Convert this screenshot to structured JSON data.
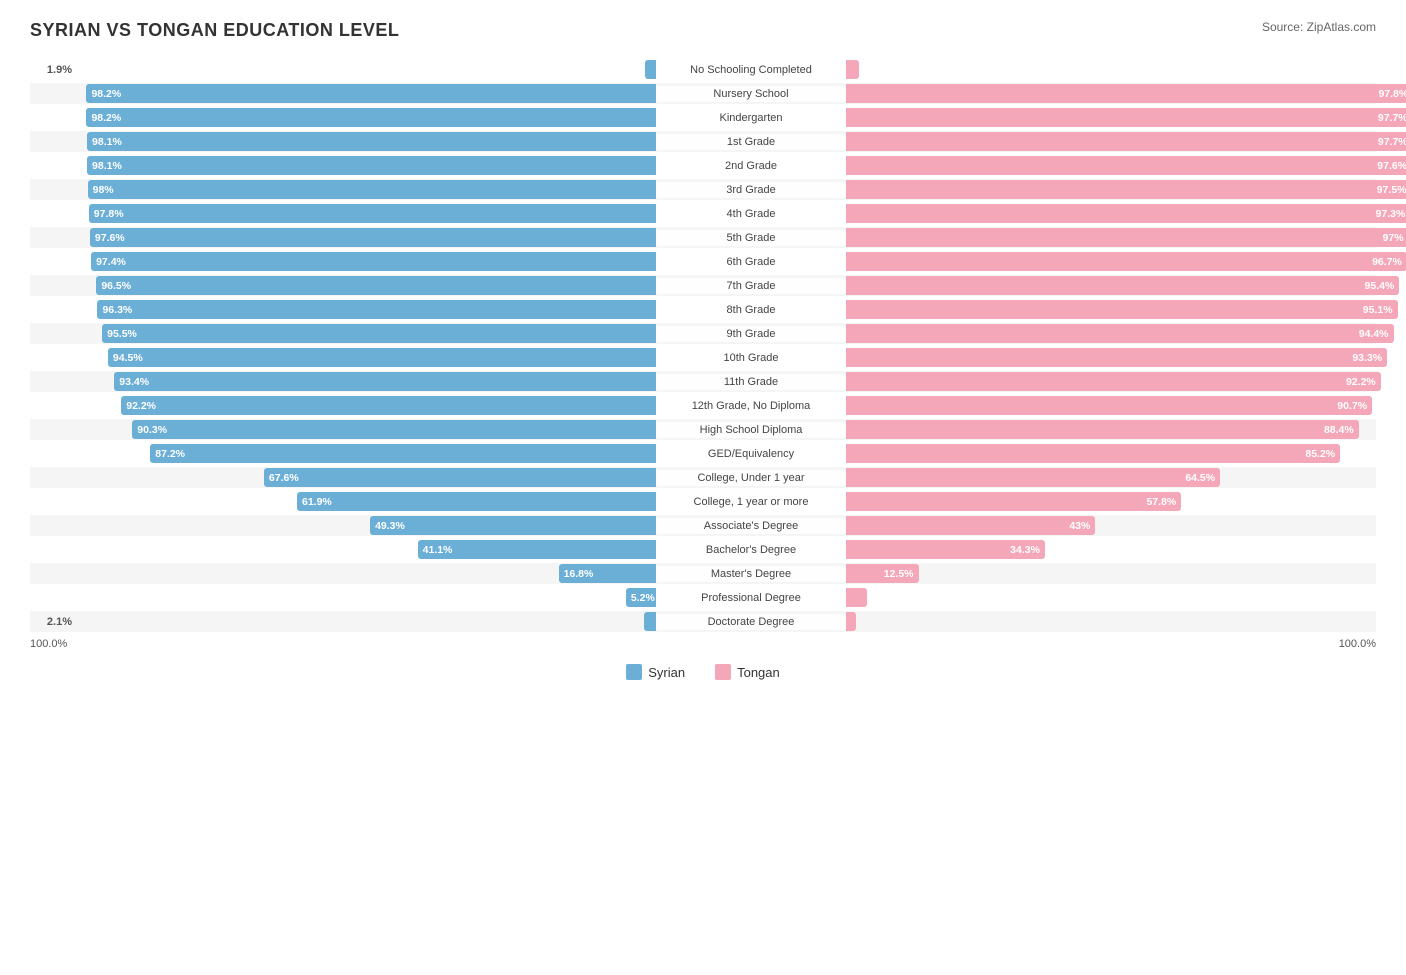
{
  "title": "SYRIAN VS TONGAN EDUCATION LEVEL",
  "source": "Source: ZipAtlas.com",
  "colors": {
    "syrian": "#6baed6",
    "tongan": "#f4a7b9"
  },
  "legend": {
    "syrian": "Syrian",
    "tongan": "Tongan"
  },
  "bottom_left": "100.0%",
  "bottom_right": "100.0%",
  "rows": [
    {
      "label": "No Schooling Completed",
      "syrian": 1.9,
      "tongan": 2.3
    },
    {
      "label": "Nursery School",
      "syrian": 98.2,
      "tongan": 97.8
    },
    {
      "label": "Kindergarten",
      "syrian": 98.2,
      "tongan": 97.7
    },
    {
      "label": "1st Grade",
      "syrian": 98.1,
      "tongan": 97.7
    },
    {
      "label": "2nd Grade",
      "syrian": 98.1,
      "tongan": 97.6
    },
    {
      "label": "3rd Grade",
      "syrian": 98.0,
      "tongan": 97.5
    },
    {
      "label": "4th Grade",
      "syrian": 97.8,
      "tongan": 97.3
    },
    {
      "label": "5th Grade",
      "syrian": 97.6,
      "tongan": 97.0
    },
    {
      "label": "6th Grade",
      "syrian": 97.4,
      "tongan": 96.7
    },
    {
      "label": "7th Grade",
      "syrian": 96.5,
      "tongan": 95.4
    },
    {
      "label": "8th Grade",
      "syrian": 96.3,
      "tongan": 95.1
    },
    {
      "label": "9th Grade",
      "syrian": 95.5,
      "tongan": 94.4
    },
    {
      "label": "10th Grade",
      "syrian": 94.5,
      "tongan": 93.3
    },
    {
      "label": "11th Grade",
      "syrian": 93.4,
      "tongan": 92.2
    },
    {
      "label": "12th Grade, No Diploma",
      "syrian": 92.2,
      "tongan": 90.7
    },
    {
      "label": "High School Diploma",
      "syrian": 90.3,
      "tongan": 88.4
    },
    {
      "label": "GED/Equivalency",
      "syrian": 87.2,
      "tongan": 85.2
    },
    {
      "label": "College, Under 1 year",
      "syrian": 67.6,
      "tongan": 64.5
    },
    {
      "label": "College, 1 year or more",
      "syrian": 61.9,
      "tongan": 57.8
    },
    {
      "label": "Associate's Degree",
      "syrian": 49.3,
      "tongan": 43.0
    },
    {
      "label": "Bachelor's Degree",
      "syrian": 41.1,
      "tongan": 34.3
    },
    {
      "label": "Master's Degree",
      "syrian": 16.8,
      "tongan": 12.5
    },
    {
      "label": "Professional Degree",
      "syrian": 5.2,
      "tongan": 3.7
    },
    {
      "label": "Doctorate Degree",
      "syrian": 2.1,
      "tongan": 1.7
    }
  ]
}
